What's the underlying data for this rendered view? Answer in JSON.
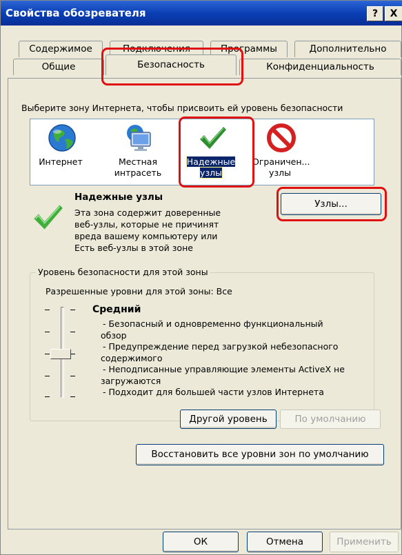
{
  "window": {
    "title": "Свойства обозревателя",
    "help_label": "?",
    "close_label": "X"
  },
  "tabs": {
    "row1": [
      "Содержимое",
      "Подключения",
      "Программы",
      "Дополнительно"
    ],
    "row2": [
      "Общие",
      "Безопасность",
      "Конфиденциальность"
    ],
    "active": "Безопасность"
  },
  "zones": {
    "instruction": "Выберите зону Интернета, чтобы присвоить ей уровень безопасности",
    "items": [
      {
        "line1": "Интернет",
        "line2": "",
        "icon": "globe-icon"
      },
      {
        "line1": "Местная",
        "line2": "интрасеть",
        "icon": "intranet-monitor-icon"
      },
      {
        "line1": "Надежные",
        "line2": "узлы",
        "icon": "checkmark-icon"
      },
      {
        "line1": "Ограничен...",
        "line2": "узлы",
        "icon": "prohibited-icon"
      }
    ],
    "selected_index": 2
  },
  "selected_zone": {
    "title": "Надежные узлы",
    "description": [
      "Эта зона содержит доверенные",
      "веб-узлы, которые не причинят",
      "вреда вашему компьютеру или",
      "Есть веб-узлы в этой зоне"
    ],
    "sites_button": "Узлы..."
  },
  "security_level": {
    "group_title": "Уровень безопасности для этой зоны",
    "allowed_text": "Разрешенные уровни для этой зоны: Все",
    "level_name": "Средний",
    "bullets": [
      "- Безопасный и одновременно функциональный",
      "обзор",
      "- Предупреждение перед загрузкой небезопасного",
      "содержимого",
      "- Неподписанные управляющие элементы ActiveX не",
      "загружаются",
      "- Подходит для большей части узлов Интернета"
    ],
    "custom_level_button": "Другой уровень",
    "default_level_button": "По умолчанию",
    "slider_level_index": 2,
    "slider_levels_total": 5
  },
  "reset_all_button": "Восстановить  все уровни зон по умолчанию",
  "footer": {
    "ok": "ОК",
    "cancel": "Отмена",
    "apply": "Применить"
  },
  "colors": {
    "titlebar": "#0a3fb4",
    "highlight_box": "#e01010",
    "selection": "#0a246a",
    "check_green": "#2f8d2f"
  }
}
